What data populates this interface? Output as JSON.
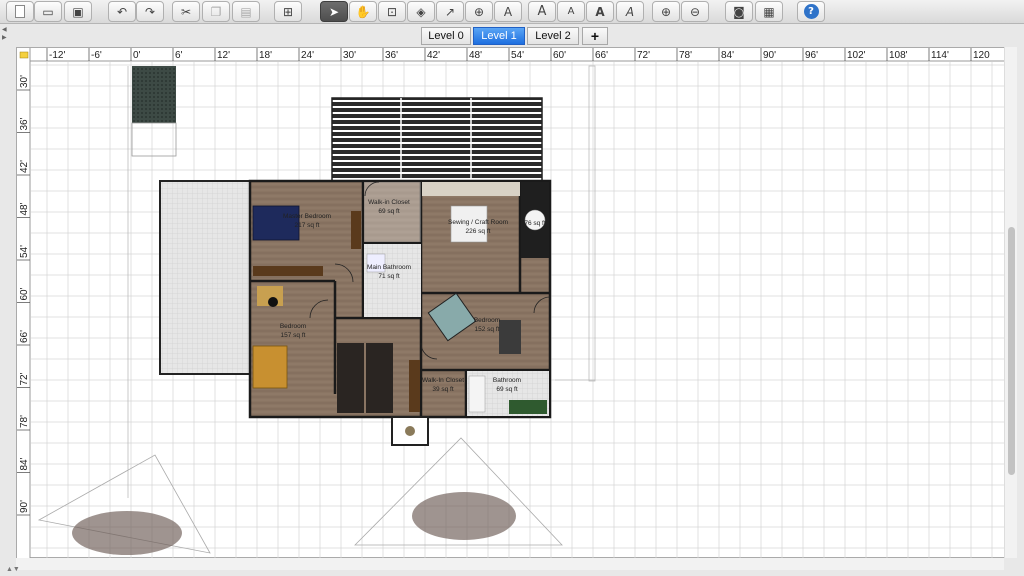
{
  "toolbar": {
    "buttons": [
      {
        "name": "new-document-button",
        "glyph": ""
      },
      {
        "name": "open-button",
        "glyph": "▭"
      },
      {
        "name": "save-button",
        "glyph": "▣"
      },
      {
        "name": "undo-button",
        "glyph": "↶"
      },
      {
        "name": "redo-button",
        "glyph": "↷"
      },
      {
        "name": "cut-button",
        "glyph": "✂"
      },
      {
        "name": "copy-button",
        "glyph": "❐"
      },
      {
        "name": "paste-button",
        "glyph": "▤"
      },
      {
        "name": "add-furniture-button",
        "glyph": "⊞"
      },
      {
        "name": "select-mode-button",
        "glyph": "➤"
      },
      {
        "name": "pan-mode-button",
        "glyph": "✋"
      },
      {
        "name": "create-walls-button",
        "glyph": "⊡"
      },
      {
        "name": "create-rooms-button",
        "glyph": "◈"
      },
      {
        "name": "create-polylines-button",
        "glyph": "↗"
      },
      {
        "name": "create-dimensions-button",
        "glyph": "⊕"
      },
      {
        "name": "add-text-button",
        "glyph": "A"
      },
      {
        "name": "increase-text-size-button",
        "glyph": "A"
      },
      {
        "name": "decrease-text-size-button",
        "glyph": "A"
      },
      {
        "name": "bold-text-button",
        "glyph": "A"
      },
      {
        "name": "italic-text-button",
        "glyph": "A"
      },
      {
        "name": "zoom-in-button",
        "glyph": "⊕"
      },
      {
        "name": "zoom-out-button",
        "glyph": "⊖"
      },
      {
        "name": "create-photo-button",
        "glyph": "◙"
      },
      {
        "name": "create-video-button",
        "glyph": "▦"
      },
      {
        "name": "help-button",
        "glyph": "?"
      }
    ]
  },
  "levels": {
    "tabs": [
      "Level 0",
      "Level 1",
      "Level 2"
    ],
    "selected": "Level 1",
    "add_label": "+"
  },
  "ruler": {
    "top": [
      "-12'",
      "-6'",
      "0'",
      "6'",
      "12'",
      "18'",
      "24'",
      "30'",
      "36'",
      "42'",
      "48'",
      "54'",
      "60'",
      "66'",
      "72'",
      "78'",
      "84'",
      "90'",
      "96'",
      "102'",
      "108'",
      "114'",
      "120"
    ],
    "left": [
      "30'",
      "36'",
      "42'",
      "48'",
      "54'",
      "60'",
      "66'",
      "72'",
      "78'",
      "84'",
      "90'"
    ]
  },
  "rooms": [
    {
      "name": "Master Bedroom",
      "area": "217 sq ft"
    },
    {
      "name": "Walk-in Closet",
      "area": "69 sq ft"
    },
    {
      "name": "Sewing / Craft Room",
      "area": "226 sq ft"
    },
    {
      "name": "",
      "area": "76 sq ft"
    },
    {
      "name": "Main Bathroom",
      "area": "71 sq ft"
    },
    {
      "name": "Bedroom",
      "area": "157 sq ft"
    },
    {
      "name": "Bedroom",
      "area": "152 sq ft"
    },
    {
      "name": "Walk-In Closet",
      "area": "39 sq ft"
    },
    {
      "name": "Bathroom",
      "area": "69 sq ft"
    }
  ],
  "colors": {
    "floor_wood": "#8a7563",
    "selection_blue": "#2a72e3",
    "wall": "#1a1a1a",
    "grid": "#d6d6d6"
  }
}
